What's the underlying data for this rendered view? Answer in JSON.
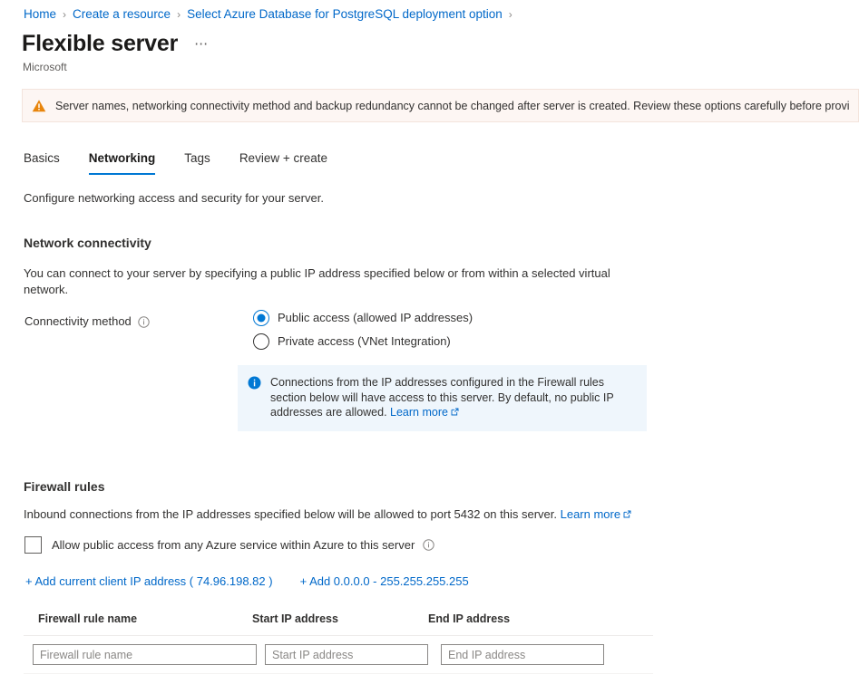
{
  "breadcrumb": {
    "items": [
      {
        "label": "Home"
      },
      {
        "label": "Create a resource"
      },
      {
        "label": "Select Azure Database for PostgreSQL deployment option"
      }
    ],
    "separator": "›"
  },
  "header": {
    "title": "Flexible server",
    "ellipsis": "⋯",
    "publisher": "Microsoft"
  },
  "warning": {
    "icon": "warning-triangle-icon",
    "text": "Server names, networking connectivity method and backup redundancy cannot be changed after server is created. Review these options carefully before provisioning",
    "background": "#fdf6f3",
    "icon_color": "#e8850c"
  },
  "tabs": [
    {
      "label": "Basics",
      "active": false
    },
    {
      "label": "Networking",
      "active": true
    },
    {
      "label": "Tags",
      "active": false
    },
    {
      "label": "Review + create",
      "active": false
    }
  ],
  "main": {
    "intro": "Configure networking access and security for your server.",
    "network_connectivity": {
      "heading": "Network connectivity",
      "description": "You can connect to your server by specifying a public IP address specified below or from within a selected virtual network.",
      "field_label": "Connectivity method",
      "options": [
        {
          "label": "Public access (allowed IP addresses)",
          "selected": true
        },
        {
          "label": "Private access (VNet Integration)",
          "selected": false
        }
      ],
      "info_box": {
        "text": "Connections from the IP addresses configured in the Firewall rules section below will have access to this server. By default, no public IP addresses are allowed. ",
        "link_label": "Learn more",
        "background": "#eff6fc",
        "icon_color": "#0078d4"
      }
    },
    "firewall_rules": {
      "heading": "Firewall rules",
      "description": "Inbound connections from the IP addresses specified below will be allowed to port 5432 on this server. ",
      "link_label": "Learn more",
      "allow_azure_checkbox": {
        "label": "Allow public access from any Azure service within Azure to this server",
        "checked": false
      },
      "actions": [
        {
          "label": "+ Add current client IP address ( 74.96.198.82 )"
        },
        {
          "label": "+ Add 0.0.0.0 - 255.255.255.255"
        }
      ],
      "table": {
        "columns": [
          "Firewall rule name",
          "Start IP address",
          "End IP address"
        ],
        "rows": [
          {
            "name_placeholder": "Firewall rule name",
            "name_value": "",
            "start_placeholder": "Start IP address",
            "start_value": "",
            "end_placeholder": "End IP address",
            "end_value": ""
          }
        ]
      }
    }
  },
  "colors": {
    "accent": "#0078d4",
    "link": "#0068c9",
    "warning": "#e8850c",
    "text": "#323130"
  }
}
